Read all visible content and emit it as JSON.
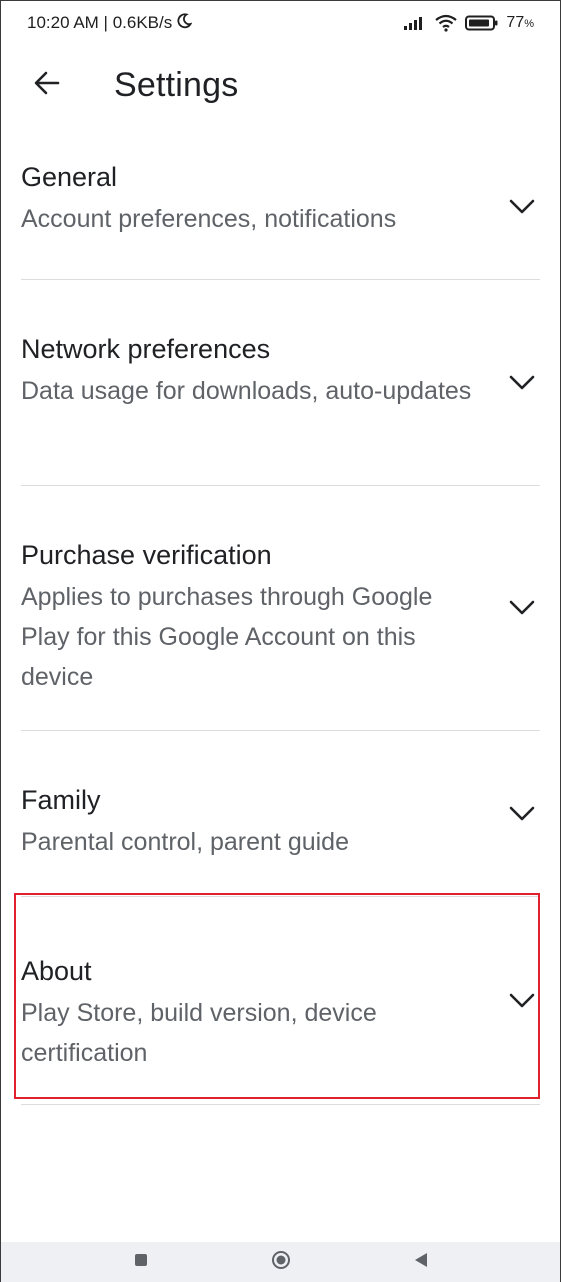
{
  "status_bar": {
    "time_speed": "10:20 AM | 0.6KB/s",
    "battery_percent": "77",
    "icons": [
      "moon-icon",
      "signal-icon",
      "wifi-icon",
      "battery-icon"
    ]
  },
  "app_bar": {
    "title": "Settings",
    "back_icon": "arrow-back-icon"
  },
  "settings": [
    {
      "title": "General",
      "description": "Account preferences, notifications"
    },
    {
      "title": "Network preferences",
      "description": "Data usage for downloads, auto-updates"
    },
    {
      "title": "Purchase verification",
      "description": "Applies to purchases through Google Play for this Google Account on this device"
    },
    {
      "title": "Family",
      "description": "Parental control, parent guide"
    },
    {
      "title": "About",
      "description": "Play Store, build version, device certification"
    }
  ],
  "highlight_color": "#e0202e",
  "nav_bar": {
    "buttons": [
      "recents-square-icon",
      "home-circle-icon",
      "back-triangle-icon"
    ]
  }
}
